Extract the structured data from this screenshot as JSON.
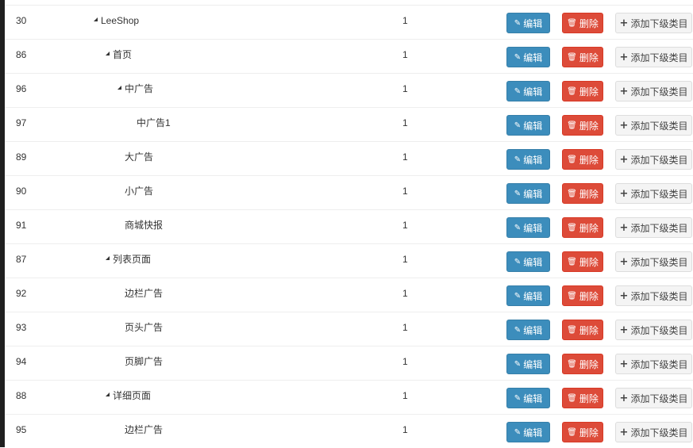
{
  "buttons": {
    "edit_label": "编辑",
    "delete_label": "删除",
    "add_child_label": "添加下级类目"
  },
  "icons": {
    "edit": "edit-icon",
    "delete": "trash-icon",
    "add": "plus-icon"
  },
  "colors": {
    "edit": "#3c8dbc",
    "delete": "#dd4b39",
    "add": "#f4f4f4"
  },
  "rows": [
    {
      "id": "30",
      "name": "LeeShop",
      "level": 0,
      "expanded": true,
      "sort": "1"
    },
    {
      "id": "86",
      "name": "首页",
      "level": 1,
      "expanded": true,
      "sort": "1"
    },
    {
      "id": "96",
      "name": "中广告",
      "level": 2,
      "expanded": true,
      "sort": "1"
    },
    {
      "id": "97",
      "name": "中广告1",
      "level": 3,
      "expanded": false,
      "sort": "1"
    },
    {
      "id": "89",
      "name": "大广告",
      "level": 2,
      "expanded": false,
      "sort": "1"
    },
    {
      "id": "90",
      "name": "小广告",
      "level": 2,
      "expanded": false,
      "sort": "1"
    },
    {
      "id": "91",
      "name": "商城快报",
      "level": 2,
      "expanded": false,
      "sort": "1"
    },
    {
      "id": "87",
      "name": "列表页面",
      "level": 1,
      "expanded": true,
      "sort": "1"
    },
    {
      "id": "92",
      "name": "边栏广告",
      "level": 2,
      "expanded": false,
      "sort": "1"
    },
    {
      "id": "93",
      "name": "页头广告",
      "level": 2,
      "expanded": false,
      "sort": "1"
    },
    {
      "id": "94",
      "name": "页脚广告",
      "level": 2,
      "expanded": false,
      "sort": "1"
    },
    {
      "id": "88",
      "name": "详细页面",
      "level": 1,
      "expanded": true,
      "sort": "1"
    },
    {
      "id": "95",
      "name": "边栏广告",
      "level": 2,
      "expanded": false,
      "sort": "1"
    }
  ]
}
